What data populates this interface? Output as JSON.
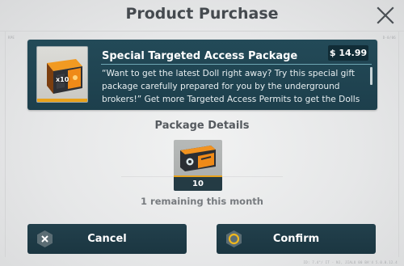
{
  "dialog": {
    "title": "Product Purchase",
    "close_icon": "close-x-icon",
    "corner_code_left": "RPE",
    "corner_code_right": "D-0/06",
    "footer_code": "ID: 7.4°/ IT · NJ, JIALU 00 BA'4 5.0.0.12.4"
  },
  "package": {
    "name": "Special Targeted Access Package",
    "price": "$ 14.99",
    "thumbnail_quantity": "x10",
    "thumbnail_icon": "orange-access-card-box-icon",
    "description": "“Want to get the latest Doll right away? Try this special gift package carefully prepared for you by the underground brokers!” Get more Targeted Access Permits to get the Dolls and weapons you want."
  },
  "details": {
    "heading": "Package Details",
    "item": {
      "icon": "targeted-access-permit-card-icon",
      "count": "10"
    },
    "remaining_text": "1 remaining this month"
  },
  "buttons": {
    "cancel_label": "Cancel",
    "cancel_icon": "hexagon-x-icon",
    "confirm_label": "Confirm",
    "confirm_icon": "hexagon-ring-icon"
  },
  "colors": {
    "panel_bg": "#1f4350",
    "button_bg": "#1e3b46",
    "accent_orange": "#e8a21c",
    "confirm_ring": "#f0b81d"
  }
}
